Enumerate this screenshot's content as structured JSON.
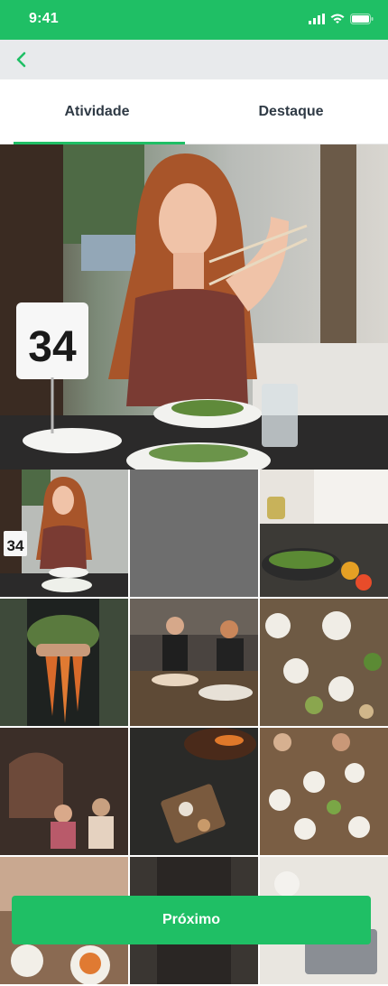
{
  "status_bar": {
    "time": "9:41"
  },
  "tabs": [
    {
      "label": "Atividade",
      "active": true
    },
    {
      "label": "Destaque",
      "active": false
    }
  ],
  "preview": {
    "table_number": "34"
  },
  "grid": {
    "thumb_table_number": "34",
    "selected_index": 0
  },
  "next_button": {
    "label": "Próximo"
  },
  "colors": {
    "accent": "#1fbf65",
    "nav_background": "#e8eaec"
  }
}
